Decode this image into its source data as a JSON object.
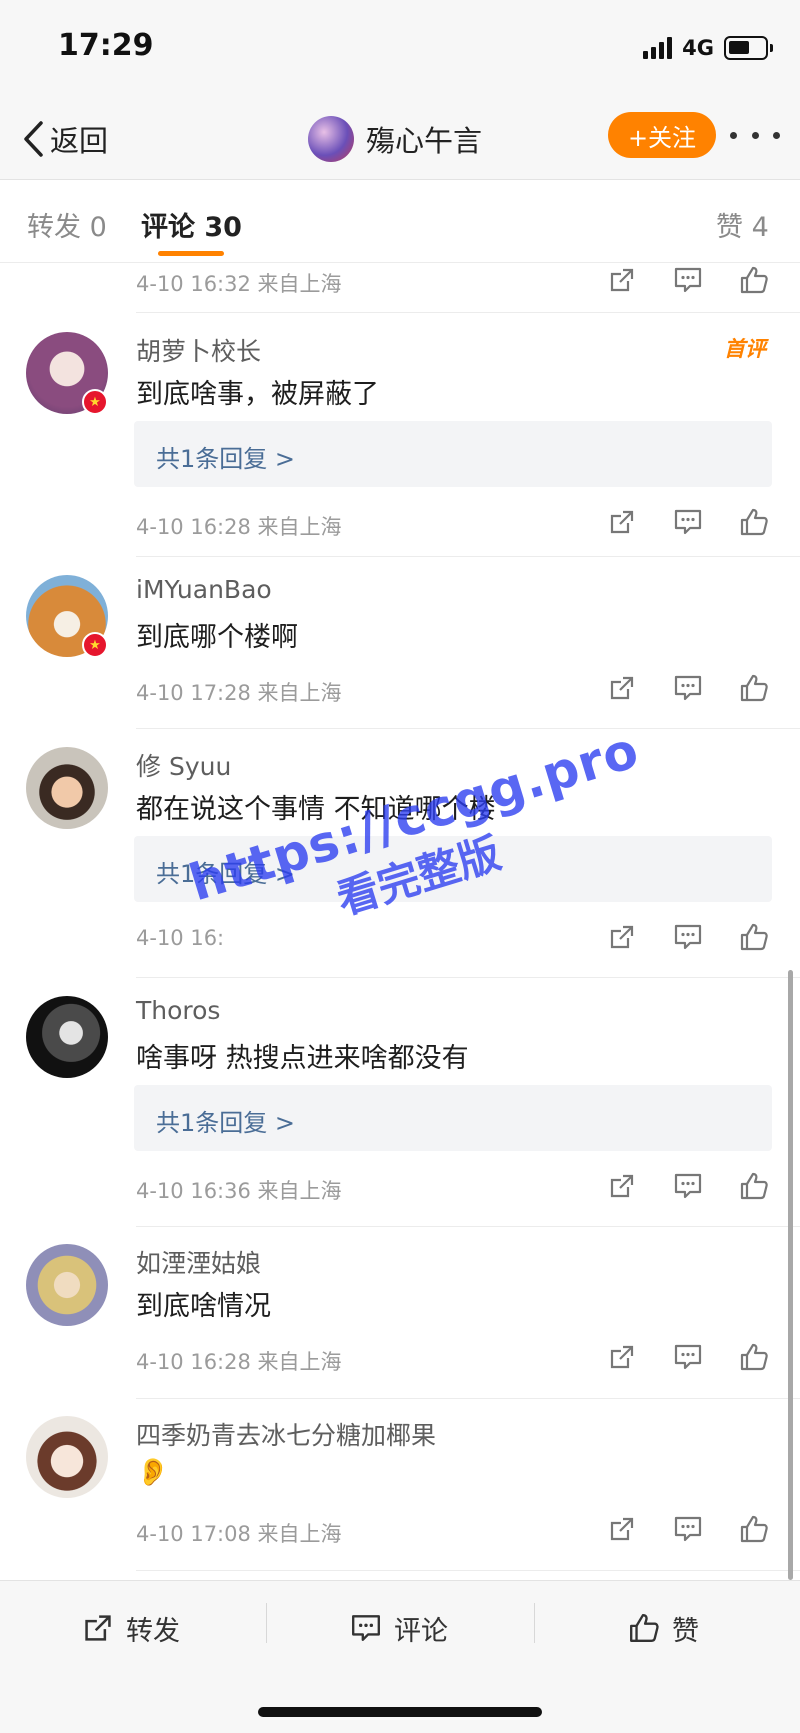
{
  "status_bar": {
    "time": "17:29",
    "network": "4G"
  },
  "nav": {
    "back_label": "返回",
    "title": "殤心午言",
    "follow_label": "+关注"
  },
  "tabs": [
    {
      "label": "转发 0"
    },
    {
      "label": "评论 30"
    },
    {
      "label": "赞 4"
    }
  ],
  "top_partial": {
    "meta": "4-10 16:32 来自上海"
  },
  "comments": [
    {
      "name": "胡萝卜校长",
      "text": "到底啥事，被屏蔽了",
      "reply": "共1条回复 >",
      "meta": "4-10 16:28 来自上海",
      "badge": "首评"
    },
    {
      "name": "iMYuanBao",
      "text": "到底哪个楼啊",
      "meta": "4-10 17:28 来自上海"
    },
    {
      "name": "修 Syuu",
      "text": "都在说这个事情 不知道哪个楼",
      "reply": "共1条回复 >",
      "meta": "4-10 16:"
    },
    {
      "name": "Thoros",
      "text": "啥事呀 热搜点进来啥都没有",
      "reply": "共1条回复 >",
      "meta": "4-10 16:36 来自上海"
    },
    {
      "name": "如湮湮姑娘",
      "text": "到底啥情况",
      "meta": "4-10 16:28 来自上海"
    },
    {
      "name": "四季奶青去冰七分糖加椰果",
      "text": "👂",
      "meta": "4-10 17:08 来自上海"
    }
  ],
  "watermark": {
    "line1": "https://ccgg.pro",
    "line2": "看完整版"
  },
  "bottom_bar": {
    "repost_label": "转发",
    "comment_label": "评论",
    "like_label": "赞"
  },
  "colors": {
    "accent": "#ff8200",
    "reply_link": "#4a6d96",
    "badge_red": "#e6162d"
  }
}
